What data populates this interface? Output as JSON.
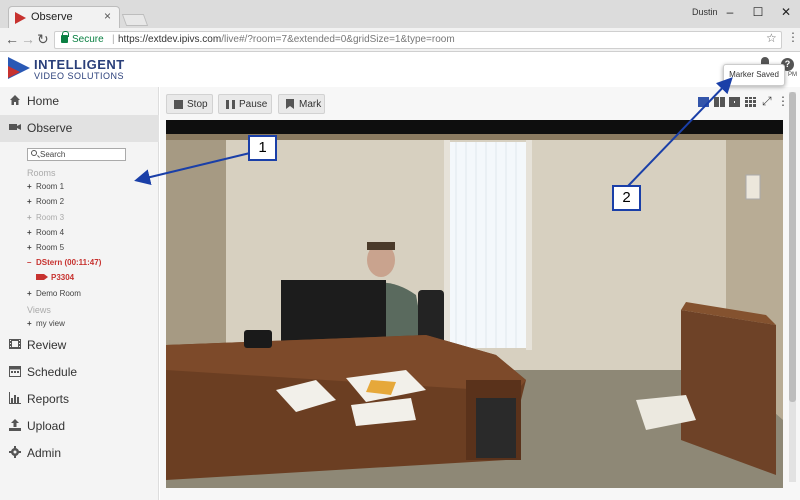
{
  "browser": {
    "tab_title": "Observe",
    "tab_close": "×",
    "user_label": "Dustin",
    "window_buttons": [
      "–",
      "☐",
      "✕"
    ],
    "nav_icons": [
      "←",
      "→",
      "↻"
    ],
    "secure_label": "Secure",
    "url_origin": "https://extdev.ipivs.com",
    "url_rest": "/live#/?room=7&extended=0&gridSize=1&type=room",
    "star": "☆",
    "menu": "⋮"
  },
  "app": {
    "logo_line1": "INTELLIGENT",
    "logo_line2": "VIDEO SOLUTIONS",
    "help": "?",
    "pm_label": "PM",
    "toast": "Marker Saved"
  },
  "sidebar": {
    "nav": [
      {
        "label": "Home",
        "icon": "home-icon"
      },
      {
        "label": "Observe",
        "icon": "video-camera-icon"
      },
      {
        "label": "Review",
        "icon": "film-icon"
      },
      {
        "label": "Schedule",
        "icon": "calendar-icon"
      },
      {
        "label": "Reports",
        "icon": "bar-chart-icon"
      },
      {
        "label": "Upload",
        "icon": "upload-icon"
      },
      {
        "label": "Admin",
        "icon": "gear-icon"
      }
    ],
    "search_placeholder": "Search",
    "rooms_header": "Rooms",
    "rooms": [
      {
        "label": "Room 1",
        "sign": "+"
      },
      {
        "label": "Room 2",
        "sign": "+"
      },
      {
        "label": "Room 3",
        "sign": "+"
      },
      {
        "label": "Room 4",
        "sign": "+"
      },
      {
        "label": "Room 5",
        "sign": "+"
      },
      {
        "label": "DStern (00:11:47)",
        "sign": "–"
      },
      {
        "label": "Demo Room",
        "sign": "+"
      }
    ],
    "active_camera": "P3304",
    "views_header": "Views",
    "views": [
      {
        "label": "my view",
        "sign": "+"
      }
    ]
  },
  "controls": {
    "stop": "Stop",
    "pause": "Pause",
    "mark": "Mark"
  },
  "annotations": {
    "callout1": "1",
    "callout2": "2"
  },
  "colors": {
    "brand_blue": "#2a59b5",
    "brand_red": "#c7322f",
    "annotation_blue": "#1a3fa8"
  }
}
